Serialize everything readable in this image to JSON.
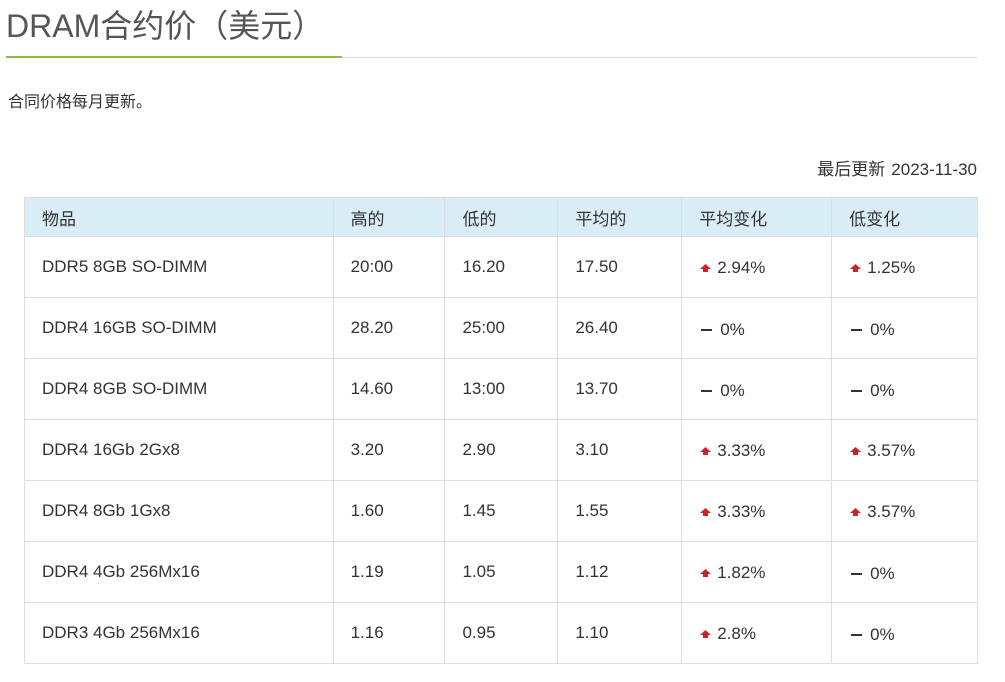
{
  "page": {
    "title": "DRAM合约价（美元）",
    "subtitle": "合同价格每月更新。",
    "updated_label": "最后更新",
    "updated_date": "2023-11-30"
  },
  "colors": {
    "accent_underline": "#8cbf3f",
    "header_bg": "#d9edf7",
    "up_arrow": "#cc2229"
  },
  "table": {
    "columns": [
      "物品",
      "高的",
      "低的",
      "平均的",
      "平均变化",
      "低变化"
    ],
    "rows": [
      {
        "item": "DDR5 8GB SO-DIMM",
        "high": "20:00",
        "low": "16.20",
        "avg": "17.50",
        "avg_change": {
          "dir": "up",
          "value": "2.94%"
        },
        "low_change": {
          "dir": "up",
          "value": "1.25%"
        }
      },
      {
        "item": "DDR4 16GB SO-DIMM",
        "high": "28.20",
        "low": "25:00",
        "avg": "26.40",
        "avg_change": {
          "dir": "flat",
          "value": "0%"
        },
        "low_change": {
          "dir": "flat",
          "value": "0%"
        }
      },
      {
        "item": "DDR4 8GB SO-DIMM",
        "high": "14.60",
        "low": "13:00",
        "avg": "13.70",
        "avg_change": {
          "dir": "flat",
          "value": "0%"
        },
        "low_change": {
          "dir": "flat",
          "value": "0%"
        }
      },
      {
        "item": "DDR4 16Gb 2Gx8",
        "high": "3.20",
        "low": "2.90",
        "avg": "3.10",
        "avg_change": {
          "dir": "up",
          "value": "3.33%"
        },
        "low_change": {
          "dir": "up",
          "value": "3.57%"
        }
      },
      {
        "item": "DDR4 8Gb 1Gx8",
        "high": "1.60",
        "low": "1.45",
        "avg": "1.55",
        "avg_change": {
          "dir": "up",
          "value": "3.33%"
        },
        "low_change": {
          "dir": "up",
          "value": "3.57%"
        }
      },
      {
        "item": "DDR4 4Gb 256Mx16",
        "high": "1.19",
        "low": "1.05",
        "avg": "1.12",
        "avg_change": {
          "dir": "up",
          "value": "1.82%"
        },
        "low_change": {
          "dir": "flat",
          "value": "0%"
        }
      },
      {
        "item": "DDR3 4Gb 256Mx16",
        "high": "1.16",
        "low": "0.95",
        "avg": "1.10",
        "avg_change": {
          "dir": "up",
          "value": "2.8%"
        },
        "low_change": {
          "dir": "flat",
          "value": "0%"
        }
      }
    ]
  }
}
